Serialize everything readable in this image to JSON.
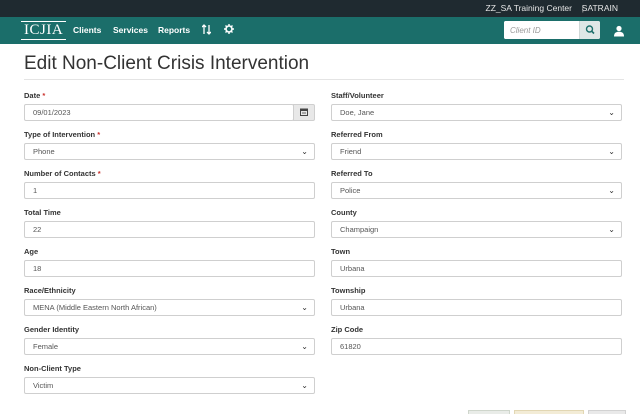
{
  "topbar": {
    "org": "ZZ_SA Training Center",
    "separator": "|",
    "user": "SATRAIN"
  },
  "navbar": {
    "logo": "ICJIA",
    "links": [
      "Clients",
      "Services",
      "Reports"
    ],
    "sort_icon": "sort-icon",
    "settings_icon": "gear-icon",
    "search_placeholder": "Client ID",
    "search_icon": "search-icon",
    "user_icon": "user-icon"
  },
  "page": {
    "title": "Edit Non-Client Crisis Intervention"
  },
  "form": {
    "date": {
      "label": "Date",
      "required": "*",
      "value": "09/01/2023"
    },
    "intervention": {
      "label": "Type of Intervention",
      "required": "*",
      "value": "Phone"
    },
    "contacts": {
      "label": "Number of Contacts",
      "required": "*",
      "value": "1"
    },
    "total_time": {
      "label": "Total Time",
      "value": "22"
    },
    "age": {
      "label": "Age",
      "value": "18"
    },
    "race": {
      "label": "Race/Ethnicity",
      "value": "MENA (Middle Eastern North African)"
    },
    "gender": {
      "label": "Gender Identity",
      "value": "Female"
    },
    "nonclient_type": {
      "label": "Non-Client Type",
      "value": "Victim"
    },
    "staff": {
      "label": "Staff/Volunteer",
      "value": "Doe, Jane"
    },
    "referred_from": {
      "label": "Referred From",
      "value": "Friend"
    },
    "referred_to": {
      "label": "Referred To",
      "value": "Police"
    },
    "county": {
      "label": "County",
      "value": "Champaign"
    },
    "town": {
      "label": "Town",
      "value": "Urbana"
    },
    "township": {
      "label": "Township",
      "value": "Urbana"
    },
    "zip": {
      "label": "Zip Code",
      "value": "61820"
    }
  },
  "colors": {
    "navbar": "#1b6e6a",
    "topbar": "#1f2a30",
    "required": "#c9302c"
  }
}
